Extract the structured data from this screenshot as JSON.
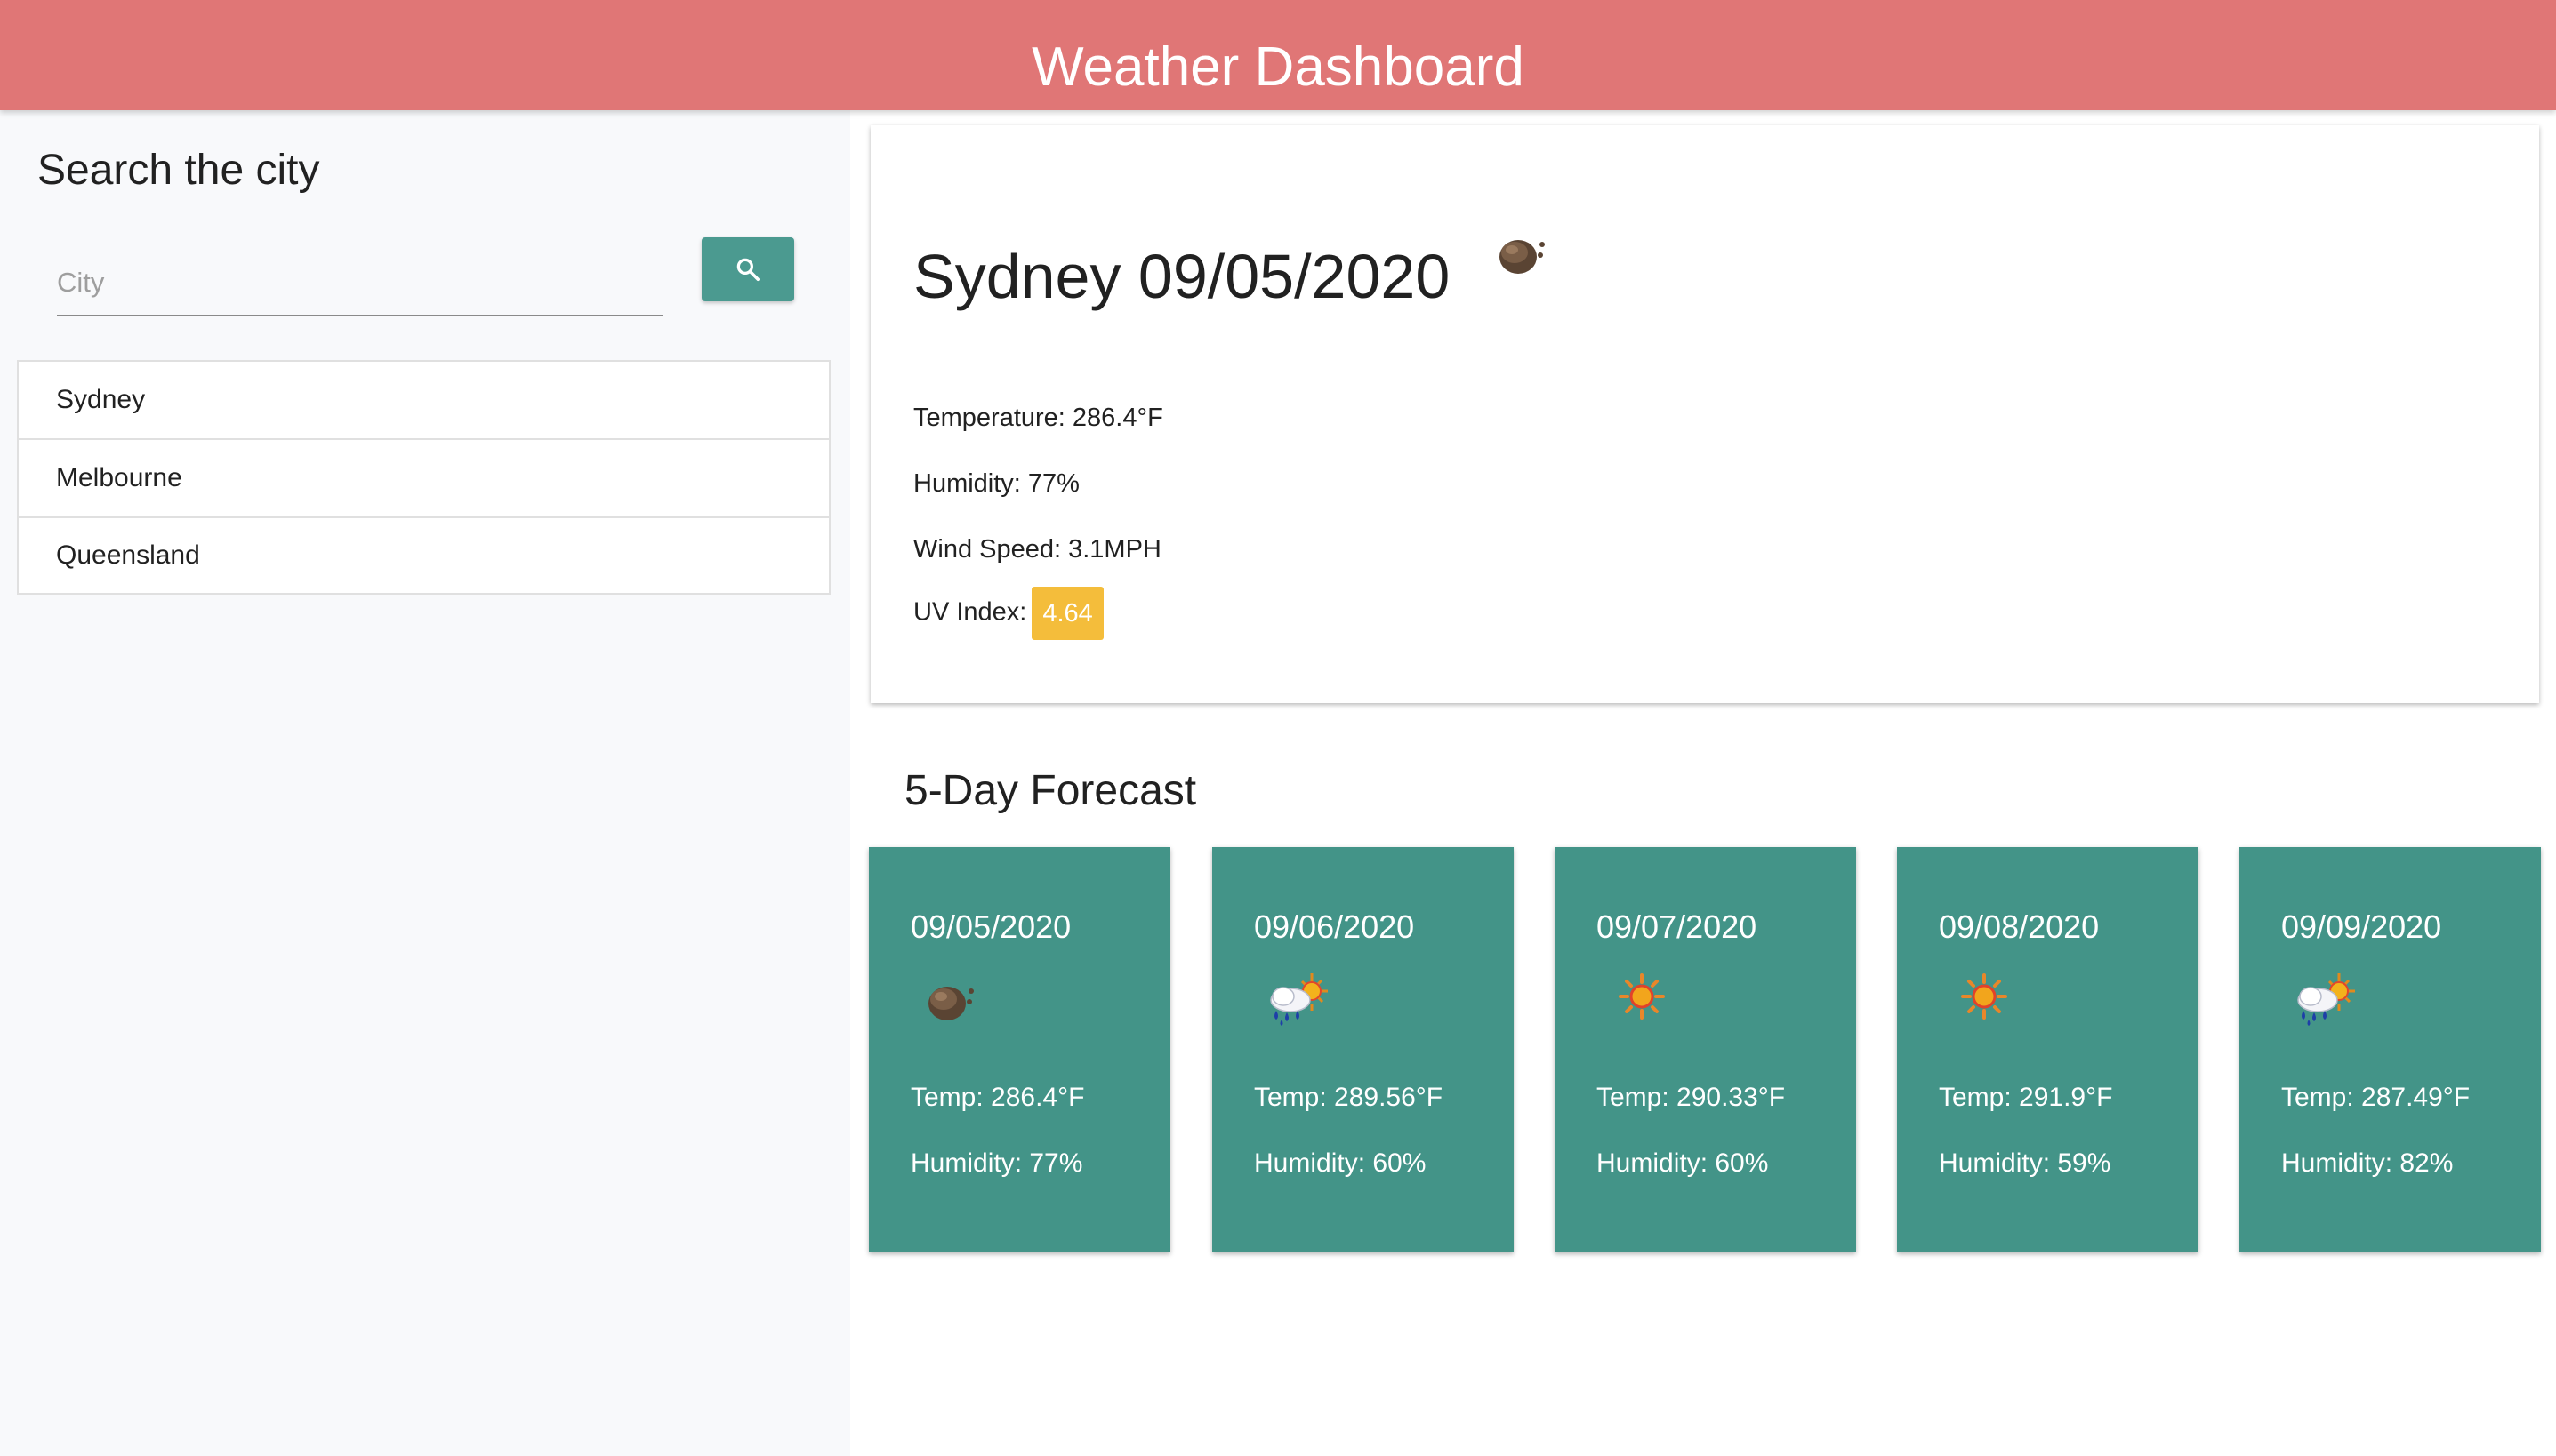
{
  "header": {
    "title": "Weather Dashboard"
  },
  "sidebar": {
    "title": "Search the city",
    "search_placeholder": "City",
    "search_button_icon": "search-icon",
    "cities": [
      "Sydney",
      "Melbourne",
      "Queensland"
    ]
  },
  "current": {
    "title": "Sydney 09/05/2020",
    "icon": "scattered-clouds-icon",
    "temperature": "Temperature: 286.4°F",
    "humidity": "Humidity: 77%",
    "wind_speed": "Wind Speed: 3.1MPH",
    "uv_label": "UV Index:",
    "uv_value": "4.64",
    "uv_color": "#f4bd3b"
  },
  "forecast": {
    "title": "5-Day Forecast",
    "days": [
      {
        "date": "09/05/2020",
        "icon": "scattered-clouds-icon",
        "temp": "Temp: 286.4°F",
        "humidity": "Humidity: 77%"
      },
      {
        "date": "09/06/2020",
        "icon": "sun-rain-icon",
        "temp": "Temp: 289.56°F",
        "humidity": "Humidity: 60%"
      },
      {
        "date": "09/07/2020",
        "icon": "sun-icon",
        "temp": "Temp: 290.33°F",
        "humidity": "Humidity: 60%"
      },
      {
        "date": "09/08/2020",
        "icon": "sun-icon",
        "temp": "Temp: 291.9°F",
        "humidity": "Humidity: 59%"
      },
      {
        "date": "09/09/2020",
        "icon": "sun-rain-icon",
        "temp": "Temp: 287.49°F",
        "humidity": "Humidity: 82%"
      }
    ]
  },
  "colors": {
    "header": "#e07676",
    "accent": "#4b9a90",
    "forecast_card": "#439488"
  }
}
